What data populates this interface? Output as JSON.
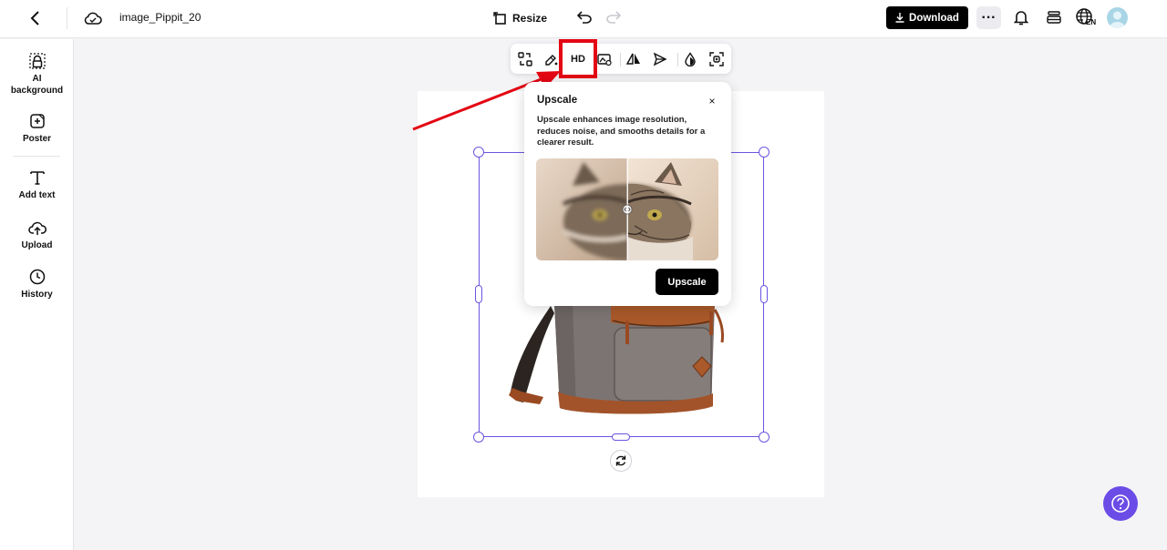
{
  "topbar": {
    "file_title": "image_Pippit_20",
    "resize_label": "Resize",
    "download_label": "Download",
    "more_label": "···",
    "language_code": "EN"
  },
  "sidebar": {
    "items": [
      {
        "label": "AI background",
        "icon": "ai-background-icon"
      },
      {
        "label": "Poster",
        "icon": "poster-icon"
      },
      {
        "label": "Add text",
        "icon": "text-icon"
      },
      {
        "label": "Upload",
        "icon": "upload-icon"
      },
      {
        "label": "History",
        "icon": "history-icon"
      }
    ]
  },
  "toolbar": {
    "hd_label": "HD"
  },
  "popover": {
    "title": "Upscale",
    "close_label": "×",
    "description": "Upscale enhances image resolution, reduces noise, and smooths details for a clearer result.",
    "button_label": "Upscale"
  },
  "colors": {
    "accent": "#6b55e0",
    "highlight": "#e30613",
    "help": "#6b4ce6"
  }
}
